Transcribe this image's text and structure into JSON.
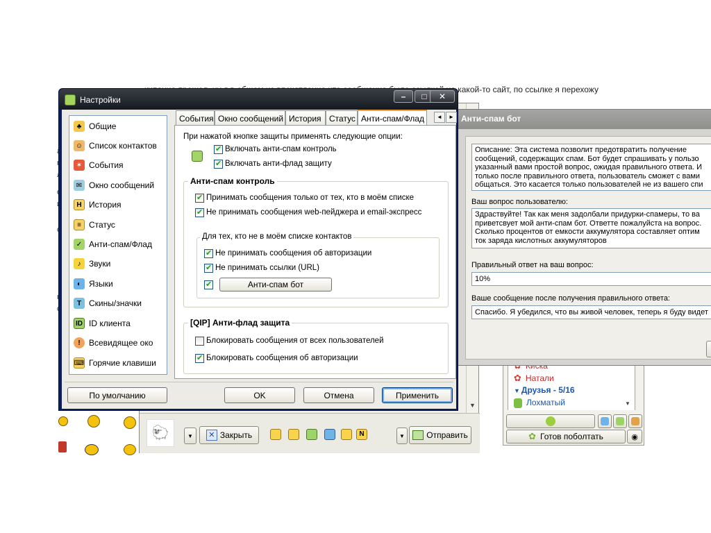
{
  "background": {
    "web_text": "кипание прошел, ну я в общем из впечатление что сообщение было ссылкой на какой-то сайт, по ссылке я перехожу",
    "left_text": [
      "а",
      "н",
      "л",
      "о",
      "и",
      "с",
      "н",
      "с"
    ]
  },
  "main_window": {
    "title": "Настройки",
    "title_buttons": [
      "–",
      "□",
      "✕"
    ],
    "nav": [
      {
        "label": "Общие",
        "icon": "general-icon"
      },
      {
        "label": "Список контактов",
        "icon": "contacts-icon"
      },
      {
        "label": "События",
        "icon": "events-icon"
      },
      {
        "label": "Окно сообщений",
        "icon": "message-window-icon"
      },
      {
        "label": "История",
        "icon": "history-icon"
      },
      {
        "label": "Статус",
        "icon": "status-icon"
      },
      {
        "label": "Анти-спам/Флад",
        "icon": "antispam-icon"
      },
      {
        "label": "Звуки",
        "icon": "sounds-icon"
      },
      {
        "label": "Языки",
        "icon": "languages-icon"
      },
      {
        "label": "Скины/значки",
        "icon": "skins-icon"
      },
      {
        "label": "ID клиента",
        "icon": "client-id-icon"
      },
      {
        "label": "Всевидящее око",
        "icon": "eye-icon"
      },
      {
        "label": "Горячие клавиши",
        "icon": "hotkeys-icon"
      }
    ],
    "tabs": [
      "События",
      "Окно сообщений",
      "История",
      "Статус",
      "Анти-спам/Флад"
    ],
    "active_tab": "Анти-спам/Флад",
    "panel": {
      "intro": "При нажатой кнопке защиты применять следующие опции:",
      "enable_antispam": "Включать анти-спам контроль",
      "enable_antiflood": "Включать анти-флад защиту",
      "antispam_group": "Анти-спам контроль",
      "only_from_list": "Принимать сообщения только от тех, кто в моём списке",
      "no_web_pager": "Не принимать сообщения web-пейджера и email-экспресс",
      "not_in_list_group": "Для тех, кто не в моём списке контактов",
      "no_auth": "Не принимать сообщения об авторизации",
      "no_links": "Не принимать ссылки (URL)",
      "antispam_bot_button": "Анти-спам бот",
      "antiflood_group": "[QIP] Анти-флад защита",
      "block_all": "Блокировать сообщения от всех пользователей",
      "block_auth": "Блокировать сообщения об авторизации"
    },
    "checkboxes": {
      "enable_antispam": true,
      "enable_antiflood": true,
      "only_from_list": true,
      "no_web_pager": true,
      "no_auth": true,
      "no_links": true,
      "bot": true,
      "block_all": false,
      "block_auth": true
    },
    "buttons": {
      "defaults": "По умолчанию",
      "ok": "OK",
      "cancel": "Отмена",
      "apply": "Применить"
    }
  },
  "bot_window": {
    "title": "Анти-спам бот",
    "description_lines": [
      "Описание: Эта система позволит предотвратить получение",
      "сообщений, содержащих спам. Бот будет спрашивать у пользо",
      "указанный вами простой вопрос, ожидая правильного ответа. И",
      "только после правильного ответа, пользователь сможет с вами",
      "общаться. Это касается только пользователей не из вашего спи"
    ],
    "question_label": "Ваш вопрос пользователю:",
    "question_lines": [
      "Здраствуйте! Так как меня задолбали придурки-спамеры, то ва",
      "приветсвует мой анти-спам бот. Ответте пожалуйста на вопрос.",
      "Сколько процентов от емкости аккумулятора составляет оптим",
      "ток заряда кислотных аккумуляторов"
    ],
    "answer_label": "Правильный ответ на ваш вопрос:",
    "answer_value": "10%",
    "after_label": "Ваше сообщение после получения правильного ответа:",
    "after_value": "Спасибо. Я убедился, что вы живой человек, теперь я буду видет"
  },
  "chat_window": {
    "close_label": "Закрыть",
    "send_label": "Отправить"
  },
  "contact_list": {
    "items": [
      "Киска",
      "Натали"
    ],
    "group_name": "Друзья",
    "group_count": "5/16",
    "contact": "Лохматый",
    "status_button": "Готов поболтать"
  },
  "colors": {
    "title_dark": "#151a22",
    "accent_tab": "#f5a23a",
    "checkbox_check": "#21a121",
    "group_blue": "#1a56b0"
  }
}
